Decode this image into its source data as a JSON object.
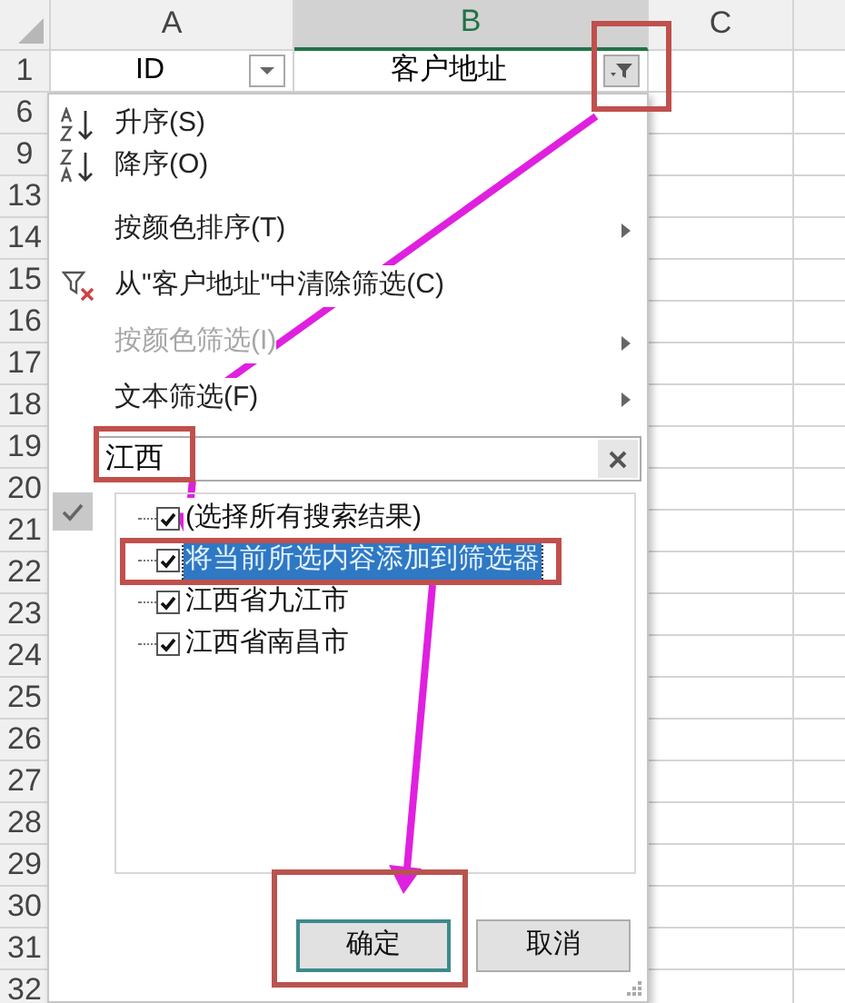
{
  "columns": [
    {
      "label": "A",
      "selected": false
    },
    {
      "label": "B",
      "selected": true
    },
    {
      "label": "C",
      "selected": false
    }
  ],
  "header_row": {
    "number": "1",
    "cells": [
      {
        "text": "ID",
        "filter_applied": false
      },
      {
        "text": "客户地址",
        "filter_applied": true
      }
    ]
  },
  "row_numbers": [
    "6",
    "9",
    "13",
    "14",
    "15",
    "16",
    "17",
    "18",
    "19",
    "20",
    "21",
    "22",
    "23",
    "24",
    "25",
    "26",
    "27",
    "28",
    "29",
    "30",
    "31",
    "32"
  ],
  "filter_menu": {
    "items": [
      {
        "kind": "sort_asc",
        "label": "升序(S)",
        "disabled": false,
        "submenu": false
      },
      {
        "kind": "sort_desc",
        "label": "降序(O)",
        "disabled": false,
        "submenu": false
      },
      {
        "kind": "plain",
        "label": "按颜色排序(T)",
        "disabled": false,
        "submenu": true
      },
      {
        "kind": "clear",
        "label": "从\"客户地址\"中清除筛选(C)",
        "disabled": false,
        "submenu": false
      },
      {
        "kind": "plain",
        "label": "按颜色筛选(I)",
        "disabled": true,
        "submenu": true
      },
      {
        "kind": "plain",
        "label": "文本筛选(F)",
        "disabled": false,
        "submenu": true
      }
    ],
    "search": {
      "value": "江西"
    },
    "values": [
      {
        "label": "(选择所有搜索结果)",
        "checked": true,
        "selected": false
      },
      {
        "label": "将当前所选内容添加到筛选器",
        "checked": true,
        "selected": true
      },
      {
        "label": "江西省九江市",
        "checked": true,
        "selected": false
      },
      {
        "label": "江西省南昌市",
        "checked": true,
        "selected": false
      }
    ],
    "buttons": [
      {
        "label": "确定",
        "default": true
      },
      {
        "label": "取消",
        "default": false
      }
    ]
  }
}
